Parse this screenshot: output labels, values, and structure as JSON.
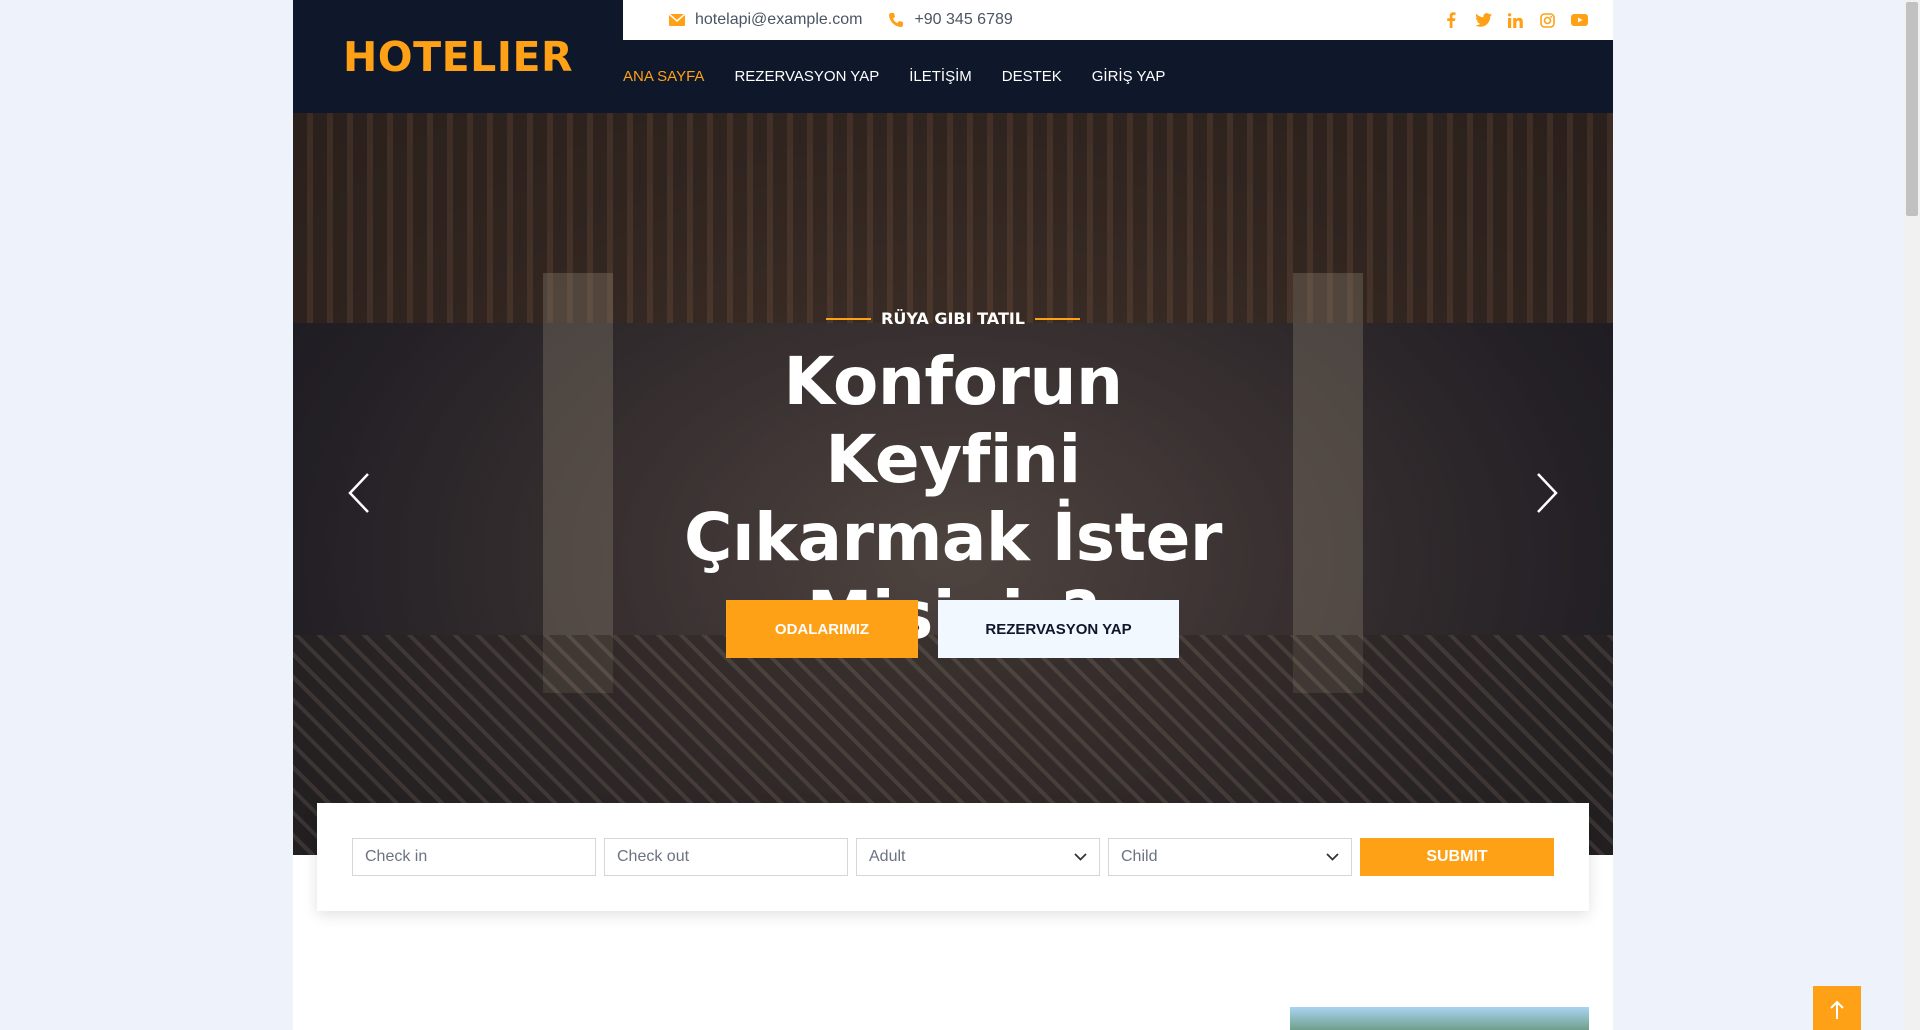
{
  "brand": {
    "logo": "HOTELIER",
    "accent_color": "#fea116",
    "dark_color": "#0f172b"
  },
  "topbar": {
    "email": "hotelapi@example.com",
    "phone": "+90 345 6789",
    "social": [
      "facebook-icon",
      "twitter-icon",
      "linkedin-icon",
      "instagram-icon",
      "youtube-icon"
    ]
  },
  "nav": {
    "items": [
      {
        "label": "ANA SAYFA",
        "active": true
      },
      {
        "label": "REZERVASYON YAP"
      },
      {
        "label": "İLETİŞİM"
      },
      {
        "label": "DESTEK"
      },
      {
        "label": "GİRİŞ YAP"
      }
    ]
  },
  "hero": {
    "eyebrow": "RÜYA GIBI TATIL",
    "title": "Konforun Keyfini Çıkarmak İster Misiniz?",
    "primary_button": "ODALARIMIZ",
    "secondary_button": "REZERVASYON YAP"
  },
  "booking": {
    "check_in_placeholder": "Check in",
    "check_out_placeholder": "Check out",
    "adult_label": "Adult",
    "child_label": "Child",
    "submit_label": "SUBMIT"
  }
}
